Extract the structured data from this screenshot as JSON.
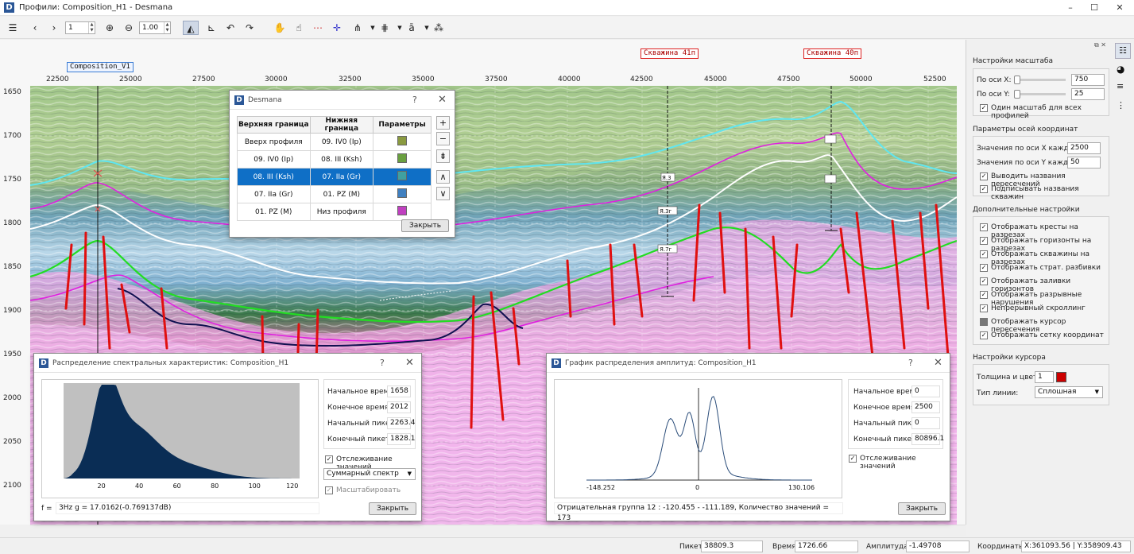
{
  "window": {
    "title": "Профили: Composition_H1 - Desmana",
    "logo": "D",
    "min": "–",
    "max": "☐",
    "close": "✕"
  },
  "toolbar": {
    "page_value": "1",
    "zoom_value": "1.00"
  },
  "plot": {
    "x_ticks": [
      "22500",
      "25000",
      "27500",
      "30000",
      "32500",
      "35000",
      "37500",
      "40000",
      "42500",
      "45000",
      "47500",
      "50000",
      "52500"
    ],
    "y_ticks": [
      "1650",
      "1700",
      "1750",
      "1800",
      "1850",
      "1900",
      "1950",
      "2000",
      "2050",
      "2100"
    ],
    "profile_label": "Composition_V1",
    "wells": [
      "Скважина 41п",
      "Скважина 40п"
    ],
    "well_markers": [
      "Я.3",
      "Я.3г",
      "Я.7г"
    ],
    "colors": {
      "horizon_white": "#ffffff",
      "horizon_green": "#22dd22",
      "horizon_cyan": "#5fe6f0",
      "horizon_magenta": "#e020e0",
      "horizon_navy": "#101050",
      "fault": "#e01010"
    }
  },
  "boundaries_dialog": {
    "title": "Desmana",
    "help": "?",
    "close_x": "✕",
    "headers": [
      "Верхняя граница",
      "Нижняя граница",
      "Параметры"
    ],
    "rows": [
      {
        "top": "Вверх профиля",
        "bottom": "09. IV0 (Ip)",
        "color": "#8a9a40",
        "selected": false
      },
      {
        "top": "09. IV0 (Ip)",
        "bottom": "08. III (Ksh)",
        "color": "#6aa040",
        "selected": false
      },
      {
        "top": "08. III (Ksh)",
        "bottom": "07. IIa (Gr)",
        "color": "#40a0a0",
        "selected": true
      },
      {
        "top": "07. IIa (Gr)",
        "bottom": "01. PZ (M)",
        "color": "#4080c0",
        "selected": false
      },
      {
        "top": "01. PZ (M)",
        "bottom": "Низ профиля",
        "color": "#c040c0",
        "selected": false
      }
    ],
    "side_buttons": [
      "+",
      "−",
      "⇟",
      "∧",
      "∨"
    ],
    "close_button": "Закрыть"
  },
  "spectrum_dialog": {
    "title": "Распределение спектральных характеристик: Composition_H1",
    "help": "?",
    "close_x": "✕",
    "x_ticks": [
      "20",
      "40",
      "60",
      "80",
      "100",
      "120"
    ],
    "fields": [
      {
        "label": "Начальное время:",
        "value": "1658"
      },
      {
        "label": "Конечное время:",
        "value": "2012"
      },
      {
        "label": "Начальный пикет:",
        "value": "2263.4"
      },
      {
        "label": "Конечный пикет:",
        "value": "1828.1"
      }
    ],
    "tracking_label": "Отслеживание значений",
    "mode_value": "Суммарный спектр",
    "scale_label": "Масштабировать",
    "f_label": "f =",
    "f_value": "3Hz g = 17.0162(-0.769137dB)",
    "close_button": "Закрыть"
  },
  "amplitude_dialog": {
    "title": "График распределения амплитуд: Composition_H1",
    "help": "?",
    "close_x": "✕",
    "x_ticks": [
      "-148.252",
      "0",
      "130.106"
    ],
    "fields": [
      {
        "label": "Начальное время:",
        "value": "0"
      },
      {
        "label": "Конечное время:",
        "value": "2500"
      },
      {
        "label": "Начальный пикет:",
        "value": "0"
      },
      {
        "label": "Конечный пикет:",
        "value": "80896.1"
      }
    ],
    "tracking_label": "Отслеживание значений",
    "status_text": "Отрицательная группа 12 : -120.455 - -111.189, Количество значений = 173",
    "close_button": "Закрыть"
  },
  "right_panel": {
    "scale_title": "Настройки масштаба",
    "axis_x_label": "По оси X:",
    "axis_x_value": "750",
    "axis_y_label": "По оси Y:",
    "axis_y_value": "25",
    "one_scale_label": "Один масштаб для всех профилей",
    "axes_title": "Параметры осей координат",
    "x_every_label": "Значения по оси X каждые:",
    "x_every_value": "2500",
    "y_every_label": "Значения по оси Y каждые:",
    "y_every_value": "50",
    "show_intersections": "Выводить названия пересечений",
    "sign_wells": "Подписывать названия скважин",
    "extra_title": "Дополнительные настройки",
    "extras": [
      {
        "label": "Отображать кресты на разрезах",
        "checked": true
      },
      {
        "label": "Отображать горизонты на разрезах",
        "checked": true
      },
      {
        "label": "Отображать скважины на разрезах",
        "checked": true
      },
      {
        "label": "Отображать страт. разбивки",
        "checked": true
      },
      {
        "label": "Отображать заливки горизонтов",
        "checked": true
      },
      {
        "label": "Отображать разрывные нарушения",
        "checked": true
      },
      {
        "label": "Непрерывный скроллинг",
        "checked": true
      },
      {
        "label": "Отображать курсор пересечения",
        "checked": false
      },
      {
        "label": "Отображать сетку координат",
        "checked": true
      }
    ],
    "cursor_title": "Настройки курсора",
    "thickness_label": "Толщина и цвет:",
    "thickness_value": "1",
    "cursor_color": "#cc0000",
    "line_type_label": "Тип линии:",
    "line_type_value": "Сплошная"
  },
  "status": {
    "picket_label": "Пикет:",
    "picket_value": "38809.3",
    "time_label": "Время:",
    "time_value": "1726.66",
    "amp_label": "Амплитуда:",
    "amp_value": "-1.49708",
    "coord_label": "Координаты:",
    "coord_value": "X:361093.56 | Y:358909.43"
  },
  "icons": [
    "menu-icon",
    "back-icon",
    "forward-icon",
    "zoom-in-icon",
    "zoom-out-icon",
    "mountain-icon",
    "chart-icon",
    "undo-icon",
    "redo-icon",
    "hand-icon",
    "pointer-icon",
    "dash-line-icon",
    "crosshair-icon",
    "wells-icon",
    "layers-icon",
    "text-icon",
    "settings-icon",
    "palette-icon",
    "list-icon"
  ]
}
